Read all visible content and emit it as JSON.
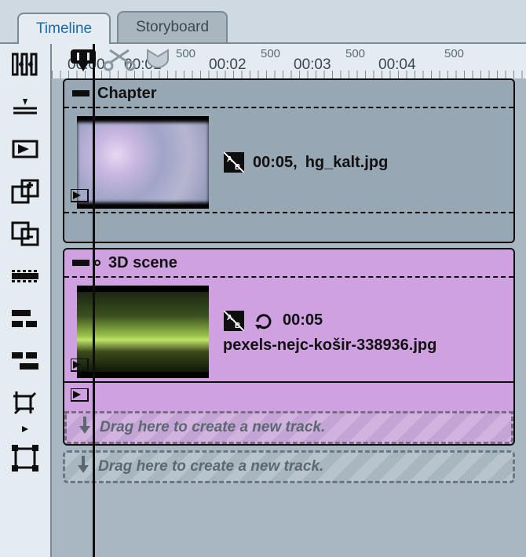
{
  "tabs": {
    "timeline": "Timeline",
    "storyboard": "Storyboard"
  },
  "ruler": {
    "sublabel": "500",
    "ticks": [
      "00:00",
      "00:01",
      "00:02",
      "00:03",
      "00:04"
    ]
  },
  "chapter1": {
    "title": "Chapter",
    "clip_time": "00:05,",
    "clip_name": "hg_kalt.jpg"
  },
  "chapter2": {
    "title": "3D scene",
    "clip_time": "00:05",
    "clip_name": "pexels-nejc-košir-338936.jpg"
  },
  "drop_hint": "Drag here to create a new track."
}
